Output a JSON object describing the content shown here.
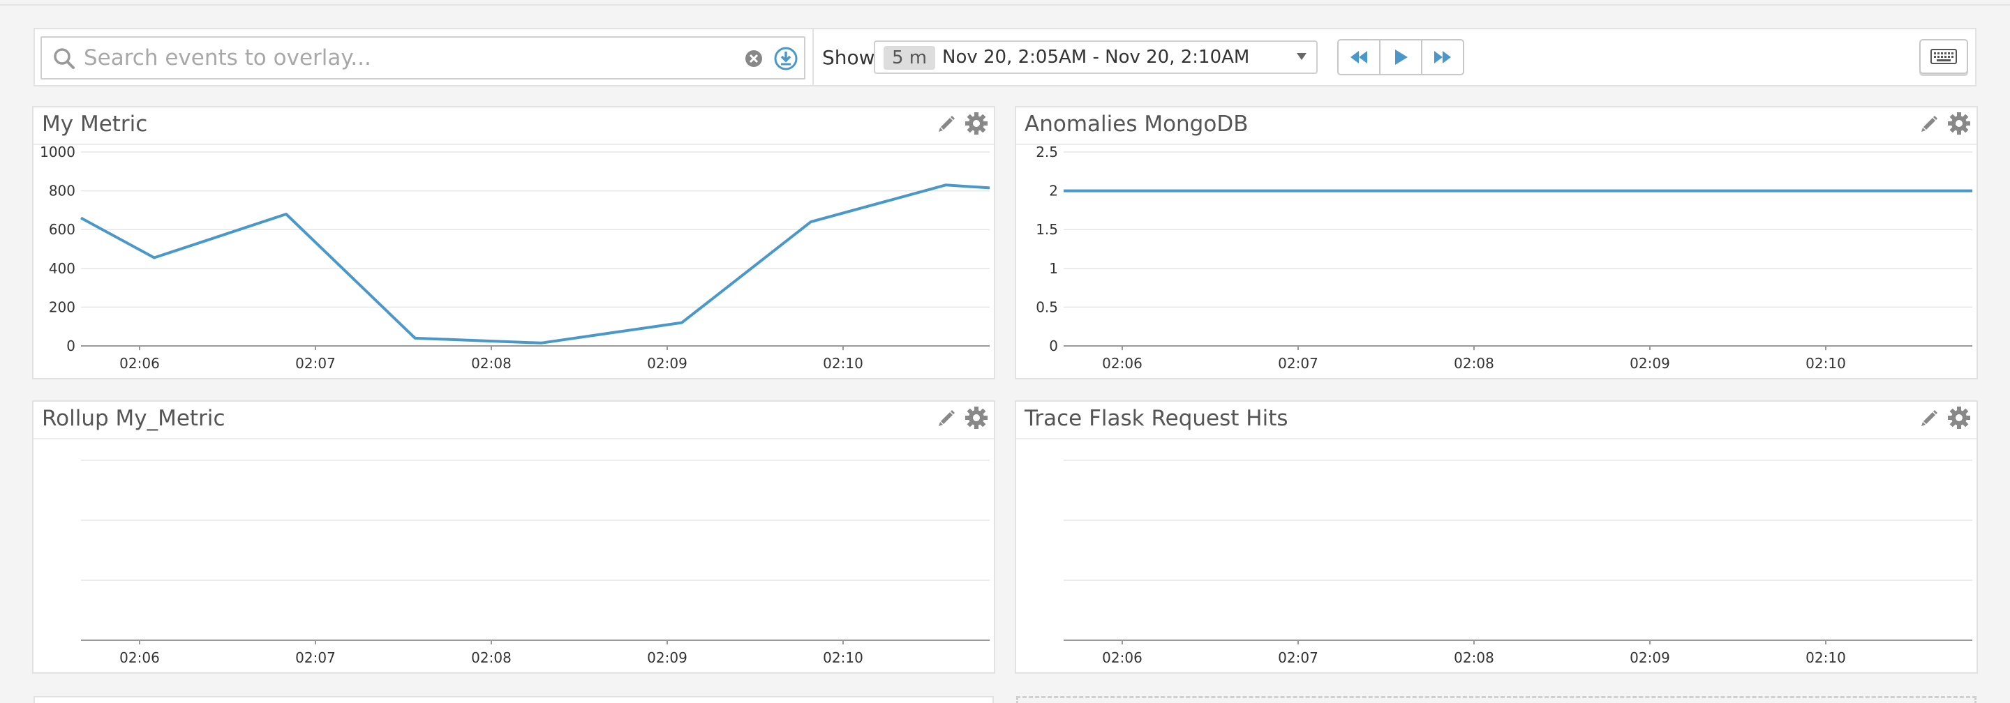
{
  "search": {
    "placeholder": "Search events to overlay..."
  },
  "timeframe": {
    "show_label": "Show",
    "pill": "5 m",
    "range": "Nov 20, 2:05AM - Nov 20, 2:10AM"
  },
  "icons": {
    "search": "search-icon",
    "clear": "clear-icon",
    "overlay": "download-circle-icon",
    "back": "rewind-icon",
    "play": "play-icon",
    "forward": "fast-forward-icon",
    "keyboard": "keyboard-icon",
    "edit": "pencil-icon",
    "settings": "gear-icon"
  },
  "colors": {
    "accent": "#4a98c9",
    "series": "#4a98c9"
  },
  "widgets": [
    {
      "title": "My Metric"
    },
    {
      "title": "Anomalies MongoDB"
    },
    {
      "title": "Rollup My_Metric"
    },
    {
      "title": "Trace Flask Request Hits"
    }
  ],
  "chart_data": [
    {
      "type": "line",
      "xticks": [
        "02:06",
        "02:07",
        "02:08",
        "02:09",
        "02:10"
      ],
      "x": [
        "02:05:40",
        "02:06:05",
        "02:06:50",
        "02:07:34",
        "02:08:17",
        "02:09:05",
        "02:09:49",
        "02:10:35",
        "02:10:50"
      ],
      "xlim": [
        "02:05:40",
        "02:10:50"
      ],
      "yticks": [
        "0",
        "200",
        "400",
        "600",
        "800",
        "1000"
      ],
      "ylim": [
        0,
        1000
      ],
      "series": [
        {
          "values": [
            660,
            455,
            680,
            40,
            15,
            120,
            640,
            830,
            815
          ]
        }
      ],
      "grid": true
    },
    {
      "type": "line",
      "xticks": [
        "02:06",
        "02:07",
        "02:08",
        "02:09",
        "02:10"
      ],
      "x": [
        "02:05:40",
        "02:10:50"
      ],
      "xlim": [
        "02:05:40",
        "02:10:50"
      ],
      "yticks": [
        "0",
        "0.5",
        "1",
        "1.5",
        "2",
        "2.5"
      ],
      "ylim": [
        0,
        2.5
      ],
      "series": [
        {
          "values": [
            2,
            2
          ]
        }
      ],
      "grid": true
    },
    {
      "type": "line",
      "xticks": [
        "02:06",
        "02:07",
        "02:08",
        "02:09",
        "02:10"
      ],
      "xlim": [
        "02:05:40",
        "02:10:50"
      ],
      "yticks": [],
      "series": [],
      "grid": true
    },
    {
      "type": "line",
      "xticks": [
        "02:06",
        "02:07",
        "02:08",
        "02:09",
        "02:10"
      ],
      "xlim": [
        "02:05:40",
        "02:10:50"
      ],
      "yticks": [],
      "series": [],
      "grid": true
    }
  ]
}
